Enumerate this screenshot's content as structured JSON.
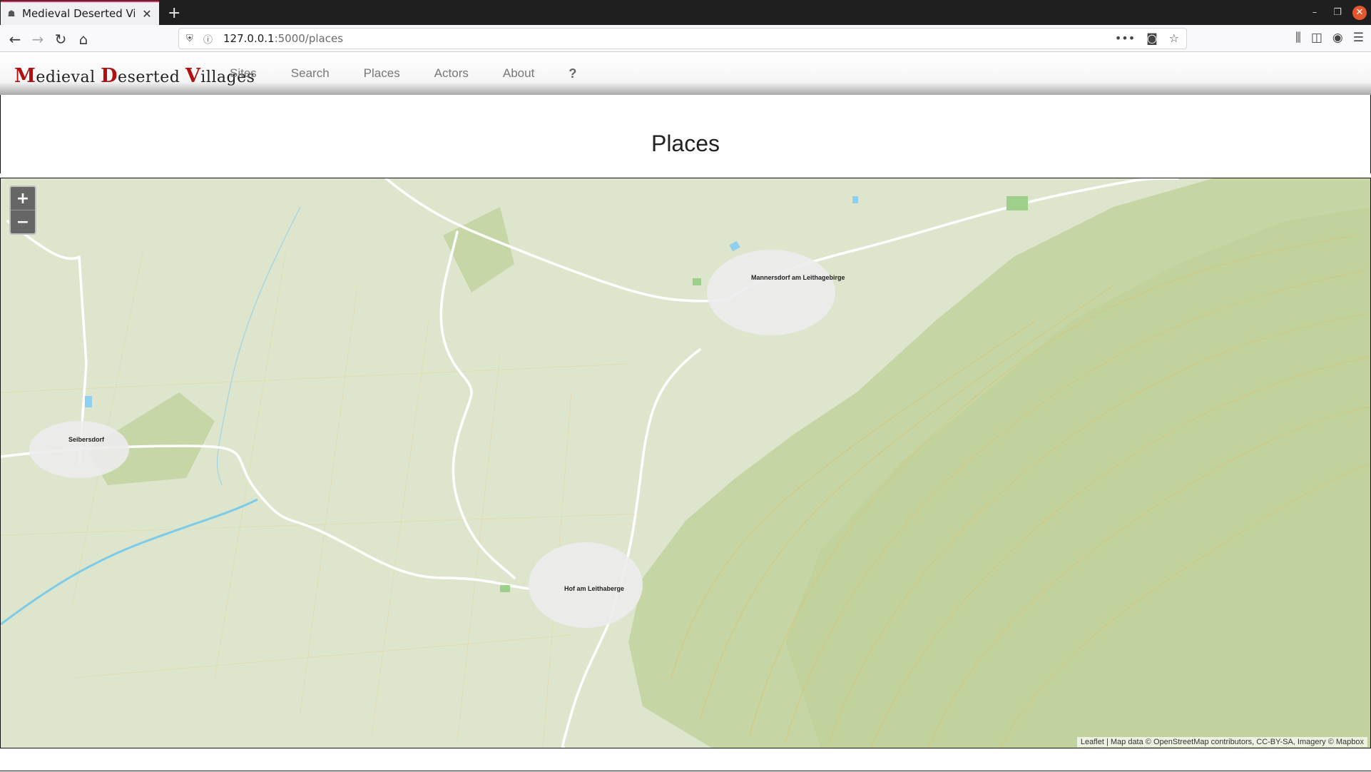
{
  "browser": {
    "tab_title": "Medieval Deserted Villag",
    "url_host": "127.0.0.1",
    "url_path": ":5000/places"
  },
  "site": {
    "brand_parts": [
      {
        "cap": "M",
        "rest": "edieval "
      },
      {
        "cap": "D",
        "rest": "eserted "
      },
      {
        "cap": "V",
        "rest": "illages"
      }
    ],
    "menu": [
      "Sites",
      "Search",
      "Places",
      "Actors",
      "About",
      "?"
    ],
    "page_title": "Places"
  },
  "map": {
    "zoom_in": "+",
    "zoom_out": "−",
    "attribution": "Leaflet | Map data © OpenStreetMap contributors, CC-BY-SA, Imagery © Mapbox",
    "towns": [
      {
        "name": "Mannersdorf am Leithagebirge"
      },
      {
        "name": "Seibersdorf"
      },
      {
        "name": "Hof am Leithaberge"
      }
    ],
    "colors": {
      "land": "#dfe6cf",
      "forest": "#c7d6a7",
      "road": "#ffffff",
      "river": "#7ccbe8",
      "contour": "#e0c06a"
    }
  }
}
